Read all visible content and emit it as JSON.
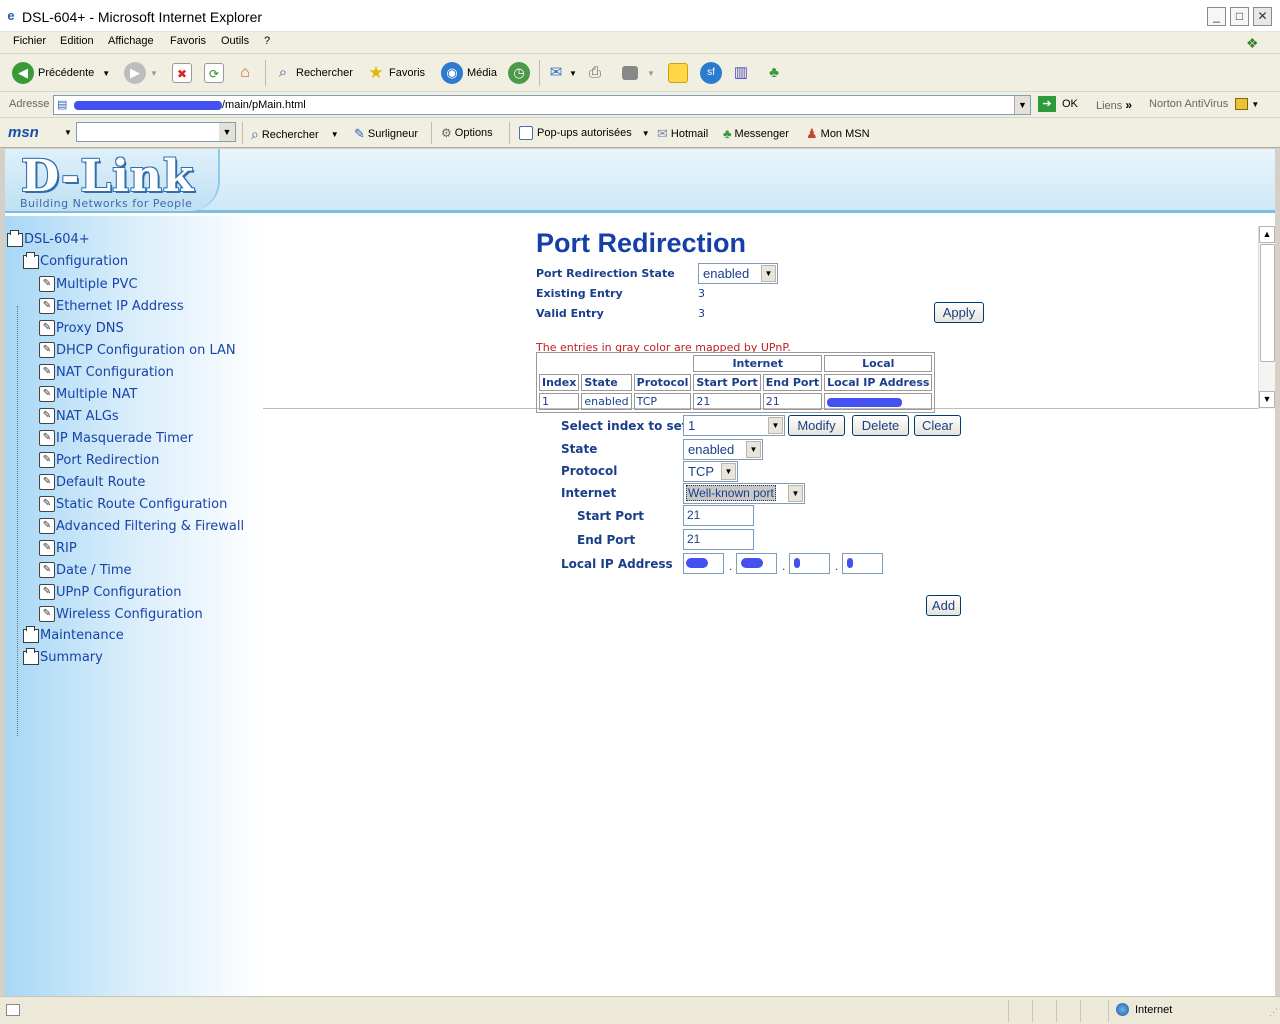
{
  "window": {
    "title": "DSL-604+ - Microsoft Internet Explorer"
  },
  "menu": [
    "Fichier",
    "Edition",
    "Affichage",
    "Favoris",
    "Outils",
    "?"
  ],
  "toolbar": {
    "back_label": "Précédente",
    "search_label": "Rechercher",
    "favorites_label": "Favoris",
    "media_label": "Média"
  },
  "address": {
    "label": "Adresse",
    "url_suffix": "/main/pMain.html",
    "go_label": "OK",
    "links_label": "Liens",
    "norton_label": "Norton AntiVirus"
  },
  "msn": {
    "logo": "msn",
    "search_label": "Rechercher",
    "highlighter_label": "Surligneur",
    "options_label": "Options",
    "popups_label": "Pop-ups autorisées",
    "hotmail_label": "Hotmail",
    "messenger_label": "Messenger",
    "mymsn_label": "Mon MSN"
  },
  "banner": {
    "logo": "D-Link",
    "tagline": "Building Networks for People"
  },
  "nav": {
    "root": "DSL-604+",
    "configuration": "Configuration",
    "items": [
      "Multiple PVC",
      "Ethernet IP Address",
      "Proxy DNS",
      "DHCP Configuration on LAN",
      "NAT Configuration",
      "Multiple NAT",
      "NAT ALGs",
      "IP Masquerade Timer",
      "Port Redirection",
      "Default Route",
      "Static Route Configuration",
      "Advanced Filtering & Firewall",
      "RIP",
      "Date / Time",
      "UPnP Configuration",
      "Wireless Configuration"
    ],
    "maintenance": "Maintenance",
    "summary": "Summary"
  },
  "top": {
    "title": "Port Redirection",
    "state_label": "Port Redirection State",
    "state_value": "enabled",
    "existing_label": "Existing Entry",
    "existing_value": "3",
    "valid_label": "Valid Entry",
    "valid_value": "3",
    "apply_label": "Apply",
    "note": "The entries in gray color are mapped by UPnP.",
    "table": {
      "group_internet": "Internet",
      "group_local": "Local",
      "headers": [
        "Index",
        "State",
        "Protocol",
        "Start Port",
        "End Port",
        "Local IP Address"
      ],
      "rows": [
        {
          "index": "1",
          "state": "enabled",
          "protocol": "TCP",
          "start": "21",
          "end": "21"
        }
      ]
    }
  },
  "form": {
    "select_label": "Select index to set",
    "select_value": "1",
    "modify_label": "Modify",
    "delete_label": "Delete",
    "clear_label": "Clear",
    "state_label": "State",
    "state_value": "enabled",
    "protocol_label": "Protocol",
    "protocol_value": "TCP",
    "internet_label": "Internet",
    "internet_value": "Well-known port",
    "start_label": "Start Port",
    "start_value": "21",
    "end_label": "End Port",
    "end_value": "21",
    "local_ip_label": "Local IP Address",
    "add_label": "Add"
  },
  "status": {
    "zone": "Internet"
  }
}
